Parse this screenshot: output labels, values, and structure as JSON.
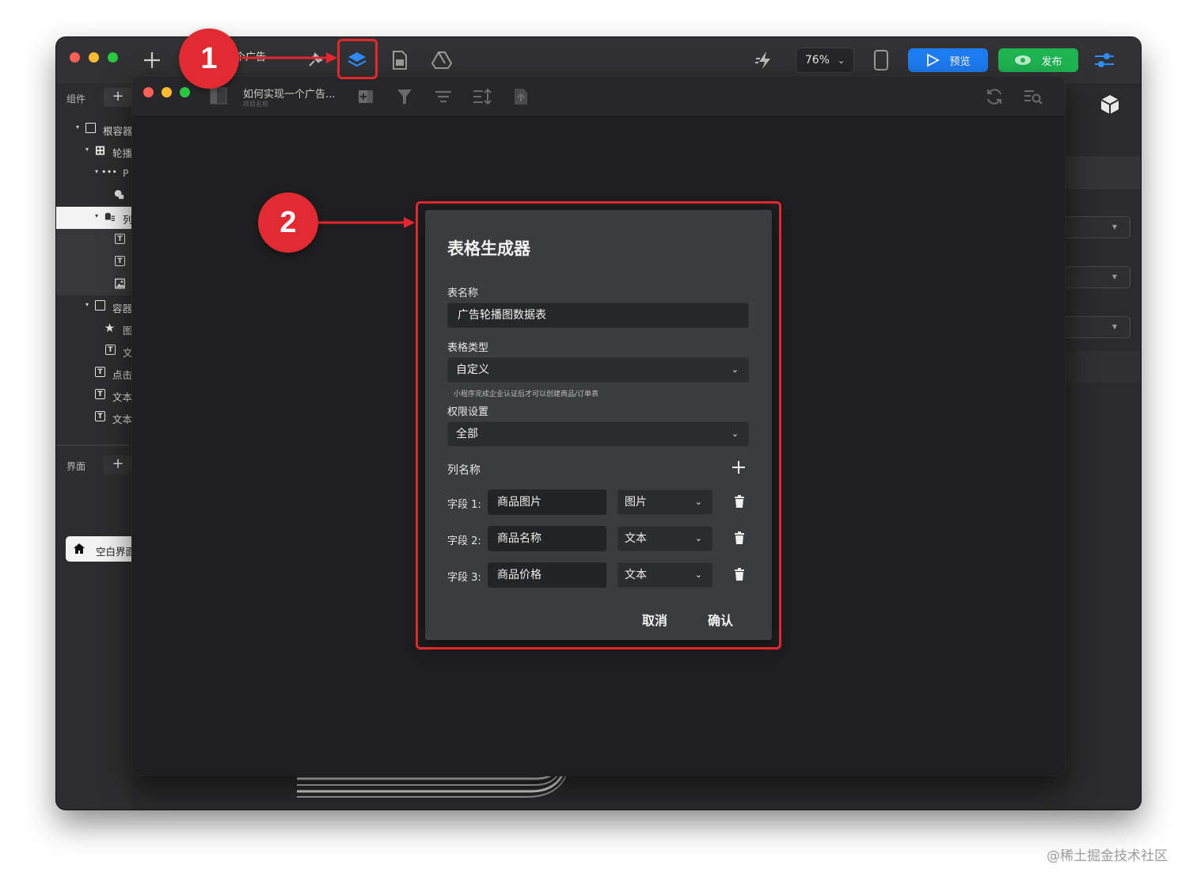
{
  "outer_window": {
    "project_title": "个广告",
    "zoom": "76%",
    "preview_label": "预览",
    "publish_label": "发布"
  },
  "left_panel": {
    "components_label": "组件",
    "pages_label": "界面",
    "tree": [
      {
        "text": "根容器"
      },
      {
        "text": "轮播"
      },
      {
        "text": "P"
      },
      {
        "text": ""
      },
      {
        "text": "列"
      },
      {
        "text": ""
      },
      {
        "text": ""
      },
      {
        "text": ""
      },
      {
        "text": "容器"
      },
      {
        "text": "图"
      },
      {
        "text": "文"
      },
      {
        "text": "点击"
      },
      {
        "text": "文本"
      },
      {
        "text": "文本"
      }
    ],
    "page_item": "空白界面"
  },
  "inner_window": {
    "project_name": "如何实现一个广告...",
    "project_sub": "项目名称"
  },
  "dialog": {
    "title": "表格生成器",
    "table_name_label": "表名称",
    "table_name_value": "广告轮播图数据表",
    "table_type_label": "表格类型",
    "table_type_value": "自定义",
    "table_type_hint": "小程序完成企业认证后才可以创建商品/订单表",
    "permission_label": "权限设置",
    "permission_value": "全部",
    "columns_label": "列名称",
    "fields": [
      {
        "label": "字段 1:",
        "name": "商品图片",
        "type": "图片"
      },
      {
        "label": "字段 2:",
        "name": "商品名称",
        "type": "文本"
      },
      {
        "label": "字段 3:",
        "name": "商品价格",
        "type": "文本"
      }
    ],
    "cancel_label": "取消",
    "confirm_label": "确认"
  },
  "annotations": {
    "step1": "1",
    "step2": "2",
    "accent_color": "#e4262f"
  },
  "watermark": "@稀土掘金技术社区"
}
